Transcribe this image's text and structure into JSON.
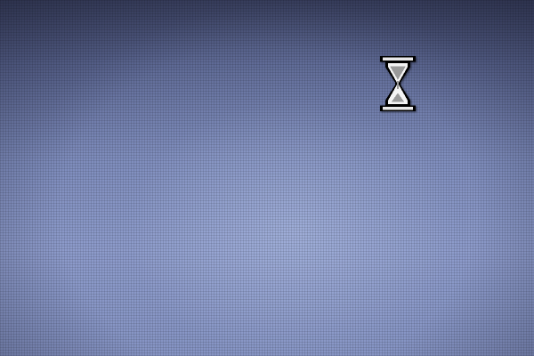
{
  "desktop": {
    "background_color": "#8391c1",
    "cursor": {
      "icon": "hourglass-icon",
      "state": "busy"
    }
  }
}
